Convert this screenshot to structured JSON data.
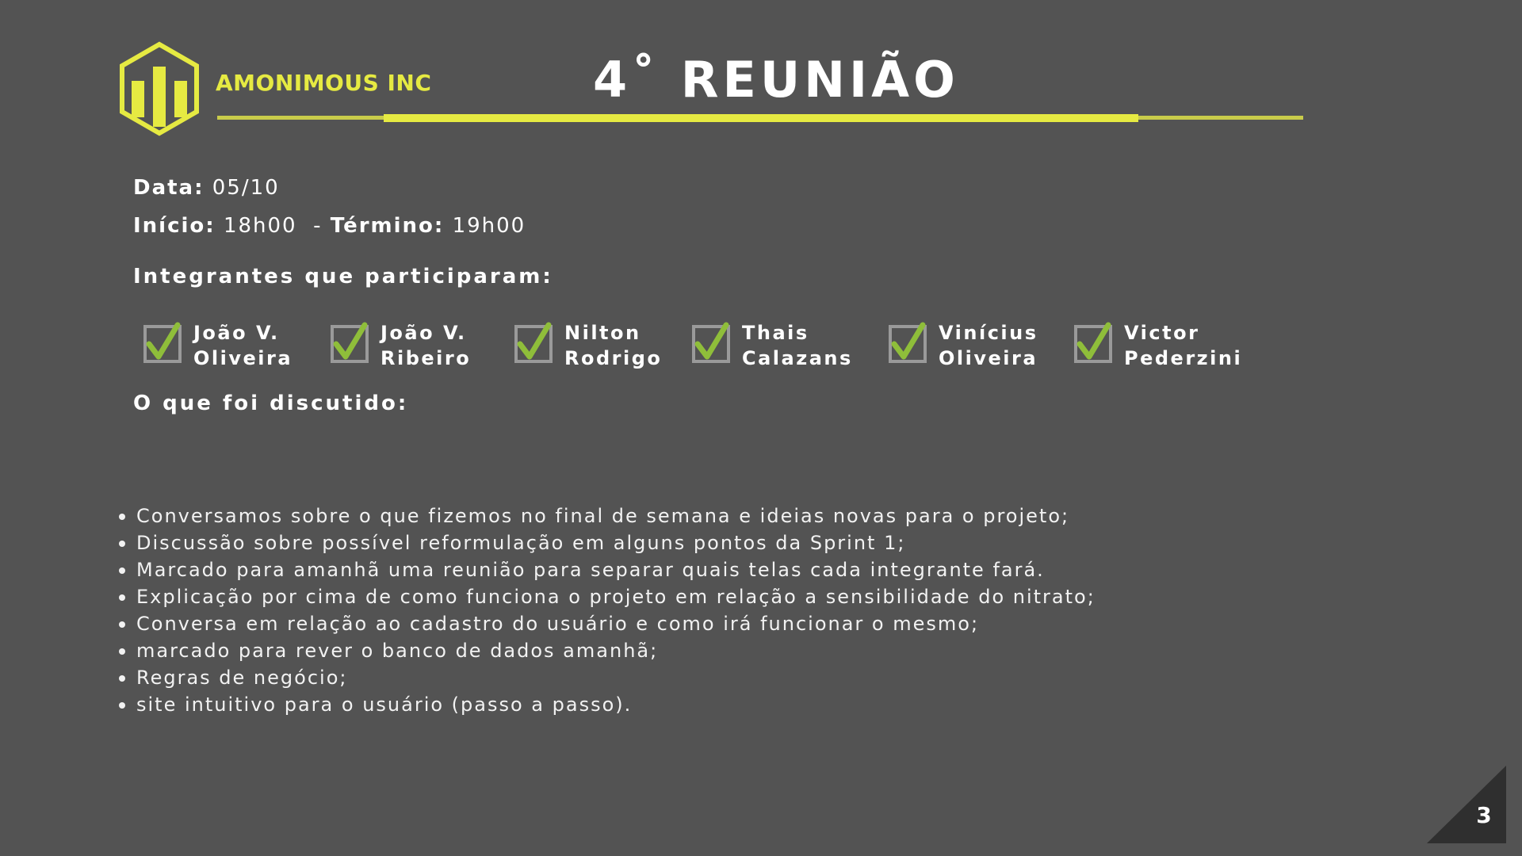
{
  "brand": {
    "name": "AMONIMOUS INC",
    "icon": "bar-chart-hexagon-logo",
    "accent_color": "#e6ea42"
  },
  "title": "4˚ REUNIÃO",
  "meta": {
    "date_label": "Data:",
    "date_value": "05/10",
    "start_label": "Início:",
    "start_value": "18h00",
    "separator": "-",
    "end_label": "Término:",
    "end_value": "19h00"
  },
  "participants_heading": "Integrantes que participaram:",
  "participants": [
    {
      "line1": "João V.",
      "line2": "Oliveira",
      "checked": true
    },
    {
      "line1": "João V.",
      "line2": "Ribeiro",
      "checked": true
    },
    {
      "line1": "Nilton",
      "line2": "Rodrigo",
      "checked": true
    },
    {
      "line1": "Thais",
      "line2": "Calazans",
      "checked": true
    },
    {
      "line1": "Vinícius",
      "line2": "Oliveira",
      "checked": true
    },
    {
      "line1": "Victor",
      "line2": "Pederzini",
      "checked": true
    }
  ],
  "check_color": "#8fbe3a",
  "discussed_heading": "O que foi discutido:",
  "discussed_items": [
    "Conversamos sobre o que fizemos no final de semana e ideias novas para o projeto;",
    "Discussão sobre possível reformulação em alguns pontos da Sprint 1;",
    "Marcado para amanhã uma reunião para separar quais telas cada integrante fará.",
    "Explicação por cima de como funciona o projeto em relação a sensibilidade do nitrato;",
    "Conversa em relação ao cadastro do usuário e como irá funcionar o mesmo;",
    "marcado para rever o banco de dados amanhã;",
    "Regras de negócio;",
    "site intuitivo para o usuário (passo a passo)."
  ],
  "page_number": "3"
}
